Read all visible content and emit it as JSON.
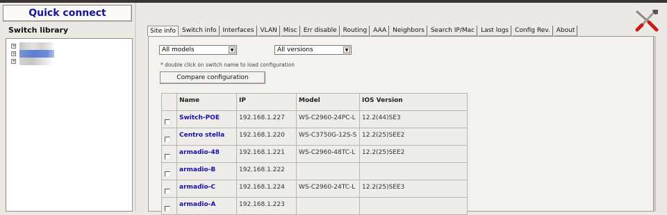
{
  "left_panel": {
    "quick_connect_label": "Quick connect",
    "library_title": "Switch library",
    "tree_toggle_symbol": "+"
  },
  "tabs": [
    {
      "label": "Site info",
      "active": true
    },
    {
      "label": "Switch info"
    },
    {
      "label": "Interfaces"
    },
    {
      "label": "VLAN"
    },
    {
      "label": "Misc"
    },
    {
      "label": "Err disable"
    },
    {
      "label": "Routing"
    },
    {
      "label": "AAA"
    },
    {
      "label": "Neighbors"
    },
    {
      "label": "Search IP/Mac"
    },
    {
      "label": "Last logs"
    },
    {
      "label": "Config Rev."
    },
    {
      "label": "About"
    }
  ],
  "filters": {
    "models_value": "All models",
    "versions_value": "All versions",
    "dropdown_arrow": "▼"
  },
  "hint": "* double click on switch name to load configuration",
  "compare_button": "Compare configuration",
  "table": {
    "headers": [
      "Name",
      "IP",
      "Model",
      "IOS Version"
    ],
    "rows": [
      {
        "name": "Switch-POE",
        "ip": "192.168.1.227",
        "model": "WS-C2960-24PC-L",
        "ios": "12.2(44)SE3"
      },
      {
        "name": "Centro stella",
        "ip": "192.168.1.220",
        "model": "WS-C3750G-12S-S",
        "ios": "12.2(25)SEE2"
      },
      {
        "name": "armadio-48",
        "ip": "192.168.1.221",
        "model": "WS-C2960-48TC-L",
        "ios": "12.2(25)SEE2"
      },
      {
        "name": "armadio-B",
        "ip": "192.168.1.222",
        "model": "",
        "ios": ""
      },
      {
        "name": "armadio-C",
        "ip": "192.168.1.224",
        "model": "WS-C2960-24TC-L",
        "ios": "12.2(25)SEE3"
      },
      {
        "name": "armadio-A",
        "ip": "192.168.1.223",
        "model": "",
        "ios": ""
      }
    ]
  },
  "colors": {
    "accent": "#1512a8",
    "tree_selection": "#5c7fd2",
    "tool_handle_red": "#cc1a1a"
  },
  "icons": {
    "tools": "tools-icon"
  }
}
